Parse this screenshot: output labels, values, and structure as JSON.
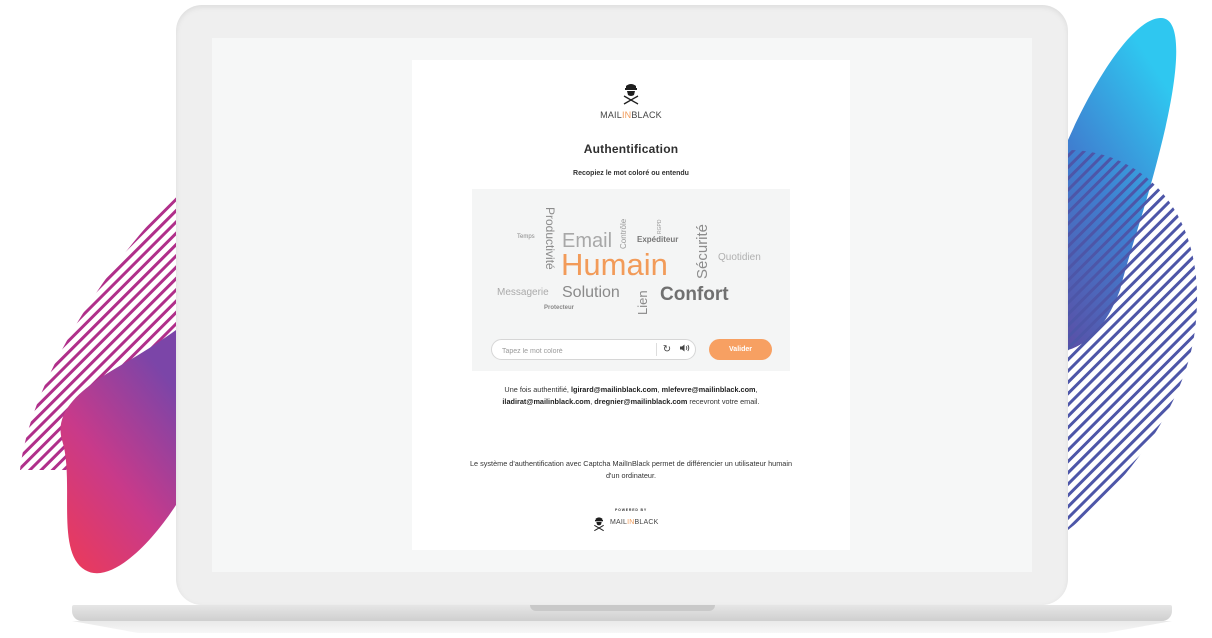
{
  "brand": {
    "pre": "MAIL",
    "mid": "IN",
    "post": "BLACK"
  },
  "title": "Authentification",
  "subtitle": "Recopiez le mot coloré ou entendu",
  "captcha": {
    "words": {
      "productivite": "Productivité",
      "temps": "Temps",
      "email": "Email",
      "controle": "Contrôle",
      "rgpd": "RGPD",
      "expediteur": "Expéditeur",
      "securite": "Sécurité",
      "quotidien": "Quotidien",
      "humain": "Humain",
      "messagerie": "Messagerie",
      "solution": "Solution",
      "lien": "Lien",
      "confort": "Confort",
      "protecteur": "Protecteur"
    },
    "input_placeholder": "Tapez le mot coloré",
    "refresh_icon": "refresh-icon",
    "audio_icon": "audio-icon",
    "validate_label": "Valider",
    "accent_color": "#f7a062"
  },
  "info": {
    "prefix": "Une fois authentifié, ",
    "email1": "lgirard@mailinblack.com",
    "sep1": ", ",
    "email2": "mlefevre@mailinblack.com",
    "sep2": ", ",
    "email3": "iladirat@mailinblack.com",
    "sep3": ", ",
    "email4": "dregnier@mailinblack.com",
    "suffix": " recevront votre email."
  },
  "footer": {
    "text": "Le système d'authentification avec Captcha MailInBlack permet de différencier un utilisateur humain d'un ordinateur.",
    "powered_by": "POWERED BY"
  }
}
